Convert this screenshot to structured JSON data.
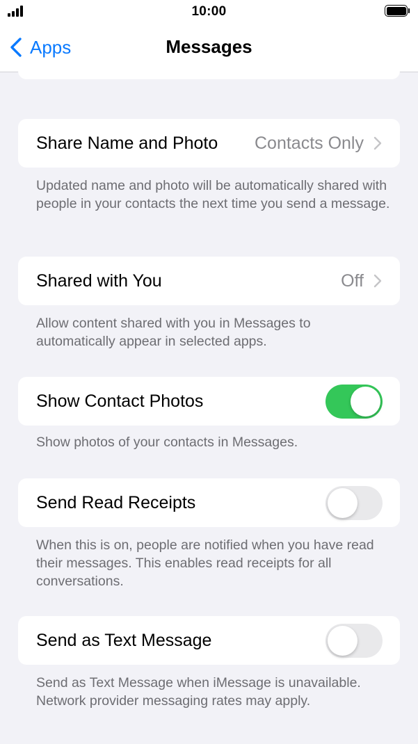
{
  "status_bar": {
    "time": "10:00"
  },
  "nav": {
    "back_label": "Apps",
    "title": "Messages"
  },
  "settings": {
    "share_name": {
      "title": "Share Name and Photo",
      "value": "Contacts Only",
      "footer": "Updated name and photo will be automatically shared with people in your contacts the next time you send a message."
    },
    "shared_with_you": {
      "title": "Shared with You",
      "value": "Off",
      "footer": "Allow content shared with you in Messages to automatically appear in selected apps."
    },
    "contact_photos": {
      "title": "Show Contact Photos",
      "on": true,
      "footer": "Show photos of your contacts in Messages."
    },
    "read_receipts": {
      "title": "Send Read Receipts",
      "on": false,
      "footer": "When this is on, people are notified when you have read their messages. This enables read receipts for all conversations."
    },
    "send_as_sms": {
      "title": "Send as Text Message",
      "on": false,
      "footer": "Send as Text Message when iMessage is unavailable. Network provider messaging rates may apply."
    }
  },
  "colors": {
    "accent": "#0a7aff",
    "toggle_on": "#34c759",
    "toggle_off": "#e9e9eb",
    "background": "#f2f2f7",
    "secondary_text": "#6d6d72"
  }
}
